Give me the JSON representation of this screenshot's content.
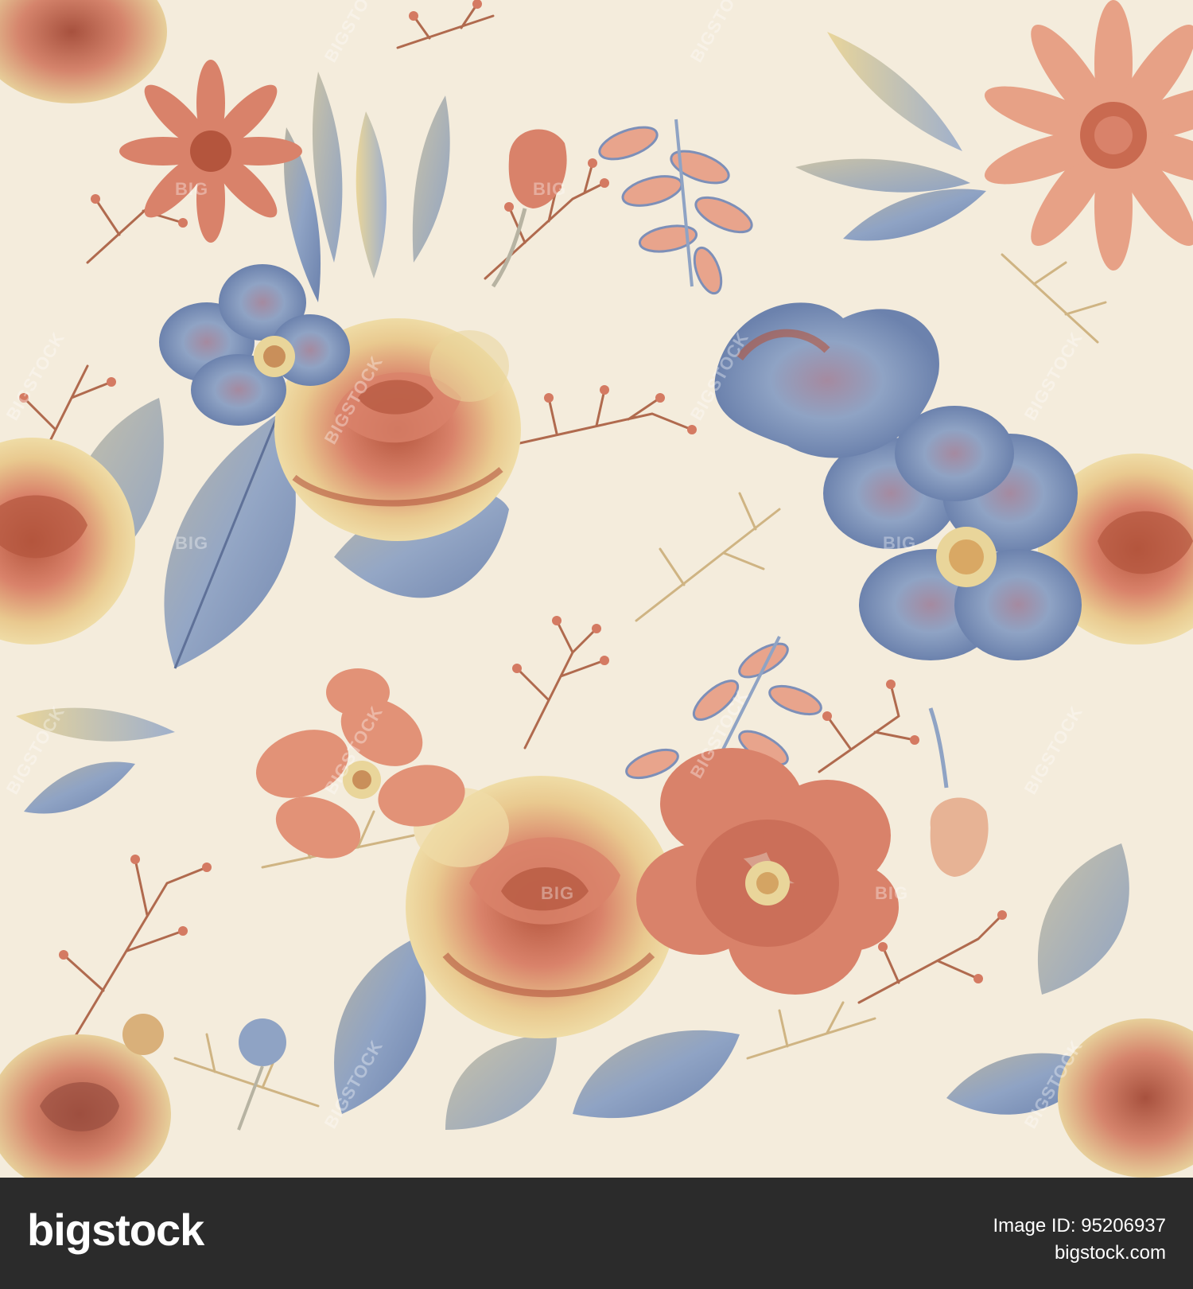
{
  "artwork": {
    "watermark_text": "BIGSTOCK",
    "watermark_short": "BIG",
    "colors": {
      "background": "#f4ecdc",
      "coral": "#d9826a",
      "rust": "#b4553d",
      "rose_pink": "#e8a48c",
      "blue_gray": "#8fa3c4",
      "slate_blue": "#6c82ad",
      "pale_yellow": "#e9d59a",
      "sage_gray": "#b7b3a2",
      "branch": "#b06a4e"
    }
  },
  "footer": {
    "logo": "bigstock",
    "image_id": "Image ID: 95206937",
    "site": "bigstock.com",
    "background": "#2b2b2b"
  }
}
